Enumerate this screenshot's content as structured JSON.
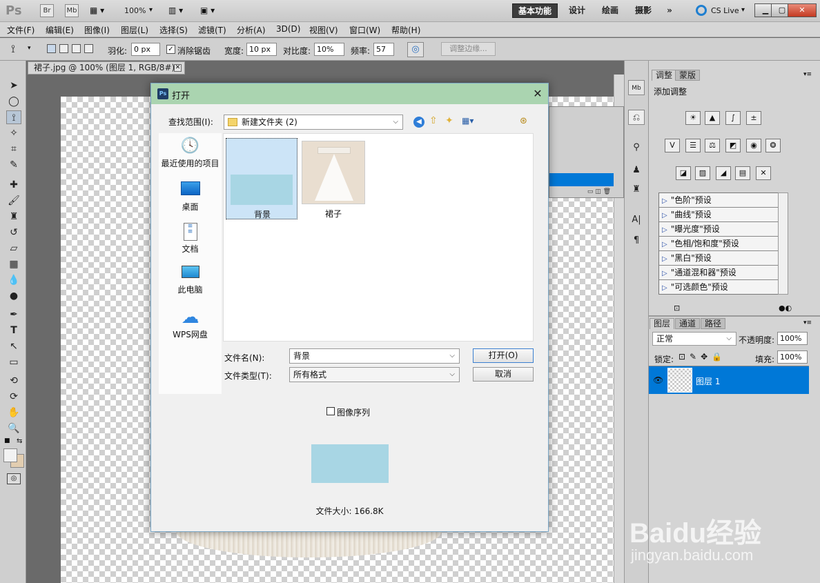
{
  "app": {
    "logo": "Ps",
    "bridge": "Br",
    "minibridge": "Mb",
    "zoom": "100%",
    "workspaces": [
      "基本功能",
      "设计",
      "绘画",
      "摄影"
    ],
    "more": "»",
    "cs_live": "CS Live"
  },
  "menu": [
    "文件(F)",
    "编辑(E)",
    "图像(I)",
    "图层(L)",
    "选择(S)",
    "滤镜(T)",
    "分析(A)",
    "3D(D)",
    "视图(V)",
    "窗口(W)",
    "帮助(H)"
  ],
  "options": {
    "feather_label": "羽化:",
    "feather_value": "0 px",
    "antialias_label": "消除锯齿",
    "width_label": "宽度:",
    "width_value": "10 px",
    "contrast_label": "对比度:",
    "contrast_value": "10%",
    "frequency_label": "频率:",
    "frequency_value": "57",
    "refine_edge": "调整边缘..."
  },
  "document": {
    "tab_title": "裙子.jpg @ 100% (图层 1, RGB/8#) *"
  },
  "adjustments": {
    "tab_active": "调整",
    "tab_other": "蒙版",
    "header": "添加调整",
    "presets": [
      "\"色阶\"预设",
      "\"曲线\"预设",
      "\"曝光度\"预设",
      "\"色相/饱和度\"预设",
      "\"黑白\"预设",
      "\"通道混和器\"预设",
      "\"可选颜色\"预设"
    ]
  },
  "layers": {
    "tabs": [
      "图层",
      "通道",
      "路径"
    ],
    "blend_mode": "正常",
    "opacity_label": "不透明度:",
    "opacity_value": "100%",
    "lock_label": "锁定:",
    "fill_label": "填充:",
    "fill_value": "100%",
    "layer_name": "图层 1"
  },
  "dialog": {
    "title": "打开",
    "look_in_label": "查找范围(I):",
    "look_in_value": "新建文件夹 (2)",
    "places": [
      "最近使用的项目",
      "桌面",
      "文档",
      "此电脑",
      "WPS网盘"
    ],
    "files": [
      "背景",
      "裙子"
    ],
    "filename_label": "文件名(N):",
    "filename_value": "背景",
    "filetype_label": "文件类型(T):",
    "filetype_value": "所有格式",
    "open_button": "打开(O)",
    "cancel_button": "取消",
    "image_sequence": "图像序列",
    "file_size": "文件大小: 166.8K"
  },
  "watermark": {
    "brand": "Baidu经验",
    "url": "jingyan.baidu.com"
  },
  "colors": {
    "accent": "#0078d7",
    "dialog_title": "#aad4b0",
    "selection": "#cce4f7"
  }
}
